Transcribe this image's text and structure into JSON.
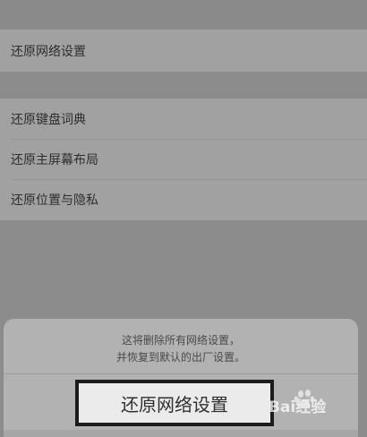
{
  "settings": {
    "group1": [
      {
        "label": "还原网络设置"
      }
    ],
    "group2": [
      {
        "label": "还原键盘词典"
      },
      {
        "label": "还原主屏幕布局"
      },
      {
        "label": "还原位置与隐私"
      }
    ]
  },
  "dialog": {
    "message_line1": "这将删除所有网络设置，",
    "message_line2": "并恢复到默认的出厂设置。",
    "confirm_label": "还原网络设置"
  },
  "watermark": {
    "text": "Bai经验"
  }
}
